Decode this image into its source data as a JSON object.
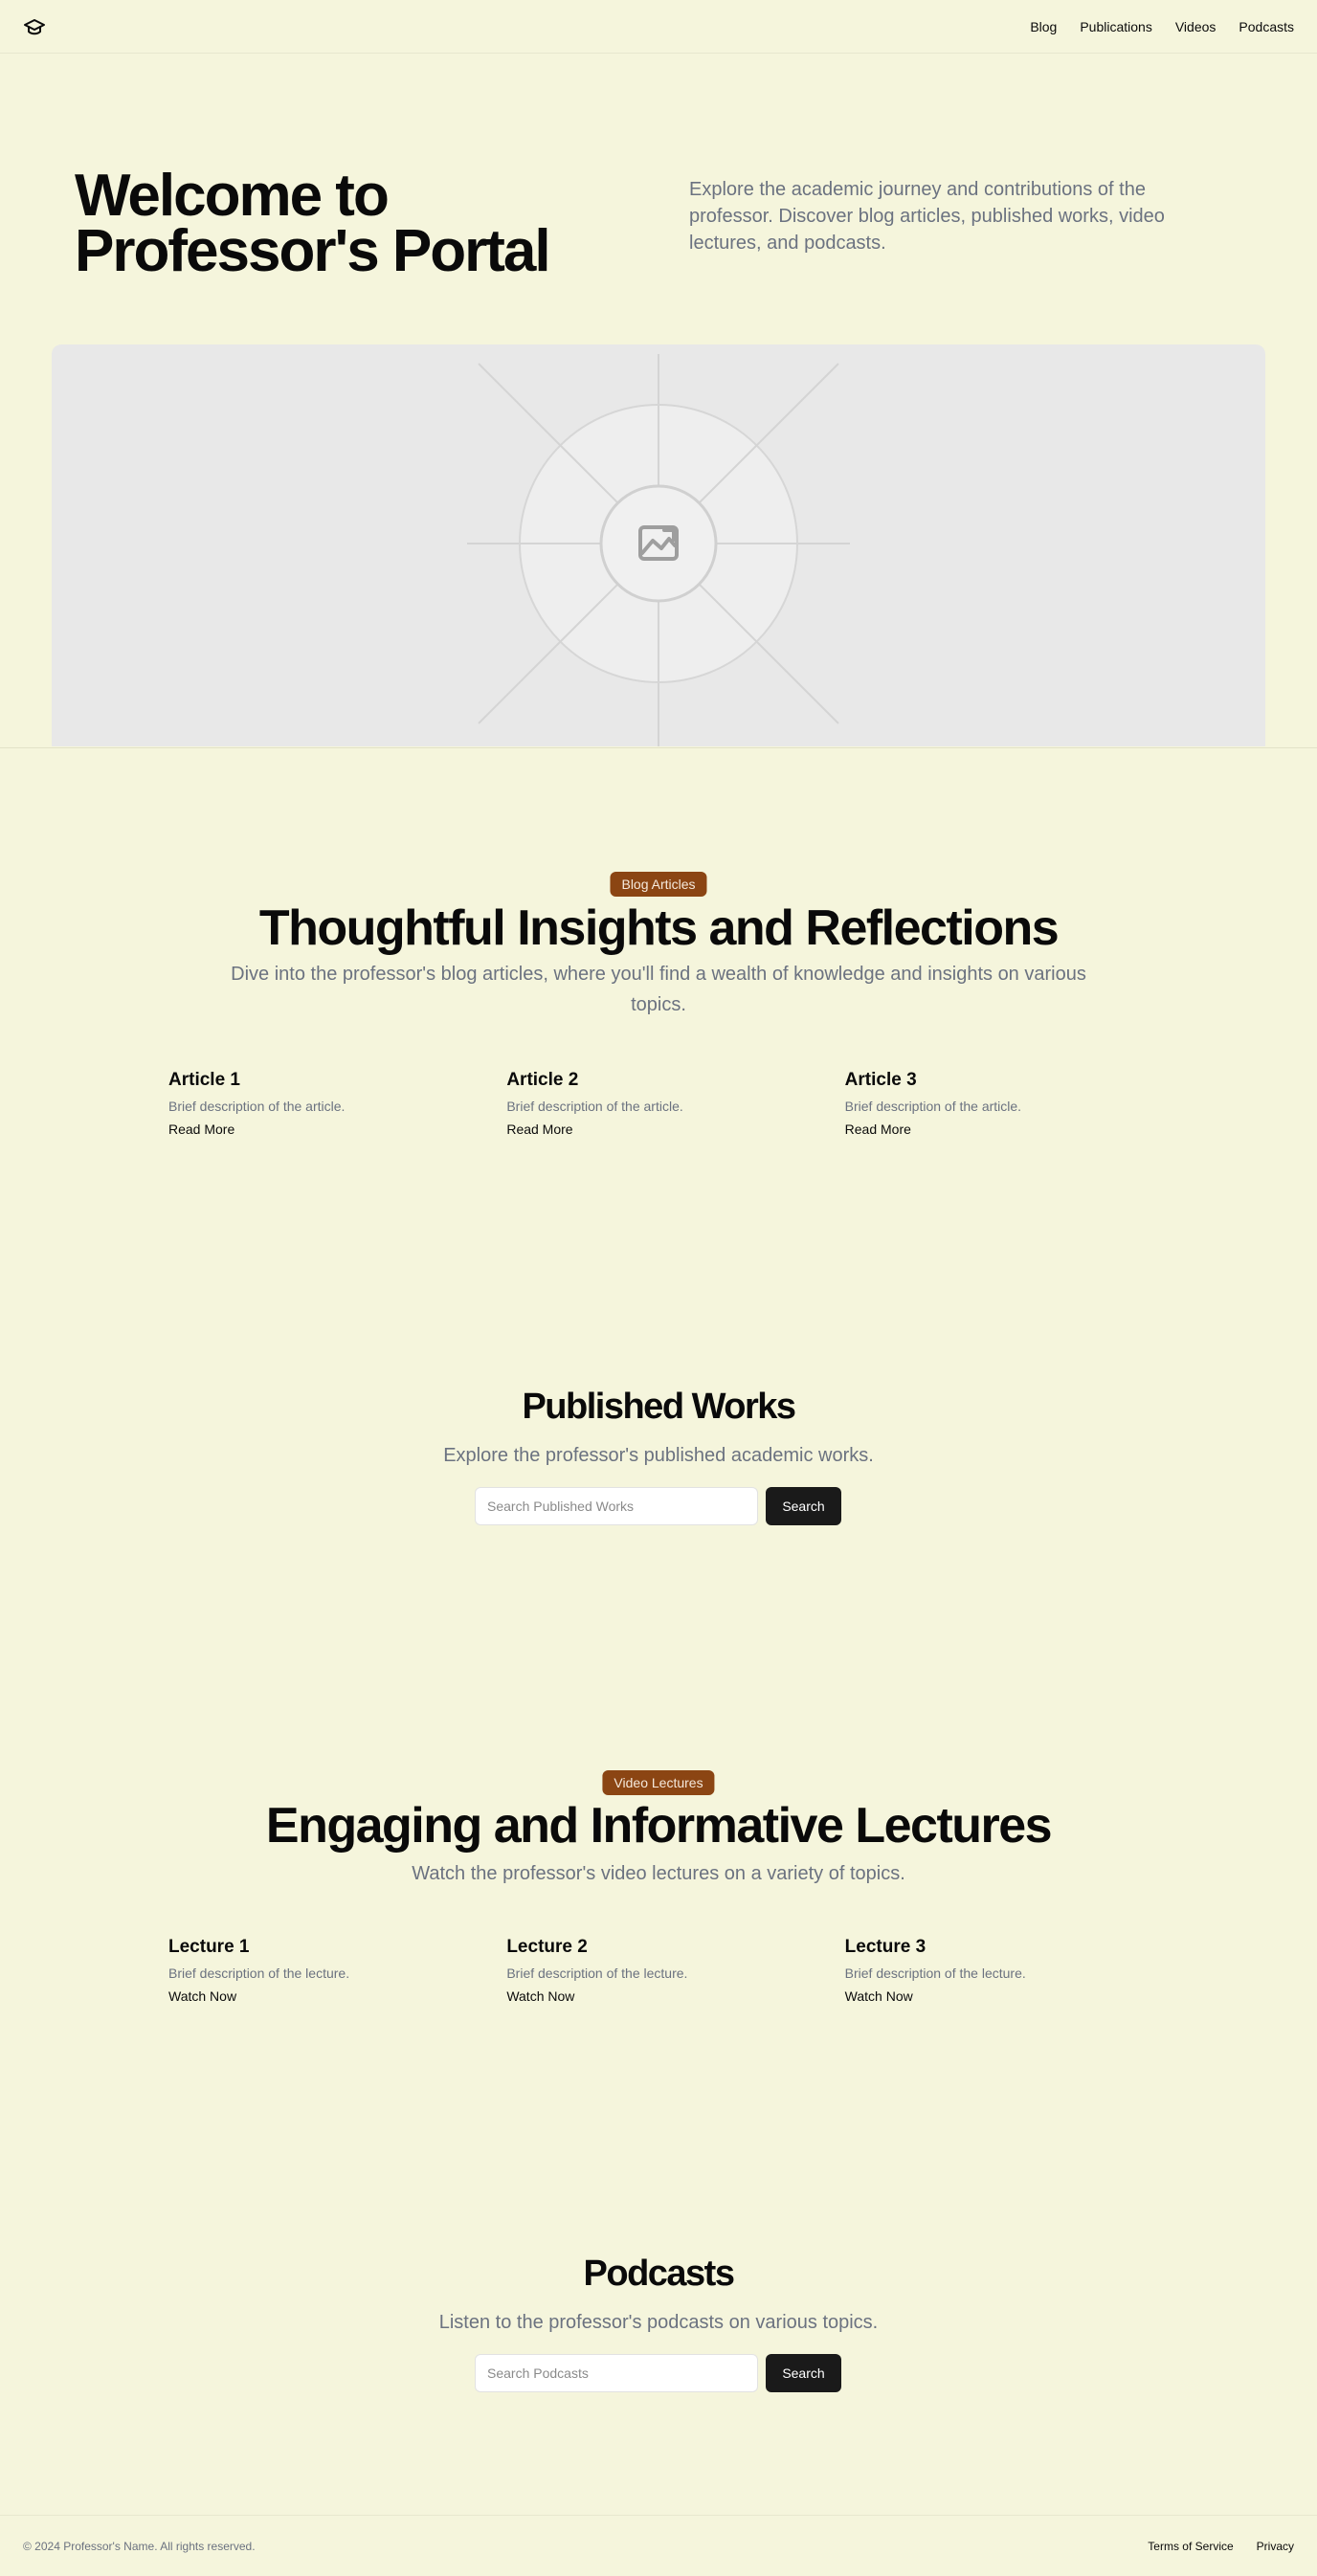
{
  "header": {
    "logo_icon": "graduation-cap-icon",
    "nav": [
      "Blog",
      "Publications",
      "Videos",
      "Podcasts"
    ]
  },
  "hero": {
    "title": "Welcome to Professor's Portal",
    "subtitle": "Explore the academic journey and contributions of the professor. Discover blog articles, published works, video lectures, and podcasts.",
    "image_icon": "image-placeholder-icon"
  },
  "blog": {
    "badge": "Blog Articles",
    "title": "Thoughtful Insights and Reflections",
    "subtitle": "Dive into the professor's blog articles, where you'll find a wealth of knowledge and insights on various topics.",
    "items": [
      {
        "title": "Article 1",
        "desc": "Brief description of the article.",
        "link": "Read More"
      },
      {
        "title": "Article 2",
        "desc": "Brief description of the article.",
        "link": "Read More"
      },
      {
        "title": "Article 3",
        "desc": "Brief description of the article.",
        "link": "Read More"
      }
    ]
  },
  "publications": {
    "title": "Published Works",
    "subtitle": "Explore the professor's published academic works.",
    "search_placeholder": "Search Published Works",
    "search_button": "Search"
  },
  "videos": {
    "badge": "Video Lectures",
    "title": "Engaging and Informative Lectures",
    "subtitle": "Watch the professor's video lectures on a variety of topics.",
    "items": [
      {
        "title": "Lecture 1",
        "desc": "Brief description of the lecture.",
        "link": "Watch Now"
      },
      {
        "title": "Lecture 2",
        "desc": "Brief description of the lecture.",
        "link": "Watch Now"
      },
      {
        "title": "Lecture 3",
        "desc": "Brief description of the lecture.",
        "link": "Watch Now"
      }
    ]
  },
  "podcasts": {
    "title": "Podcasts",
    "subtitle": "Listen to the professor's podcasts on various topics.",
    "search_placeholder": "Search Podcasts",
    "search_button": "Search"
  },
  "footer": {
    "copyright": "© 2024 Professor's Name. All rights reserved.",
    "links": [
      "Terms of Service",
      "Privacy"
    ]
  },
  "colors": {
    "background": "#f5f5dc",
    "badge": "#8b4513",
    "button": "#1a1a1a",
    "muted_text": "#6b7280"
  }
}
